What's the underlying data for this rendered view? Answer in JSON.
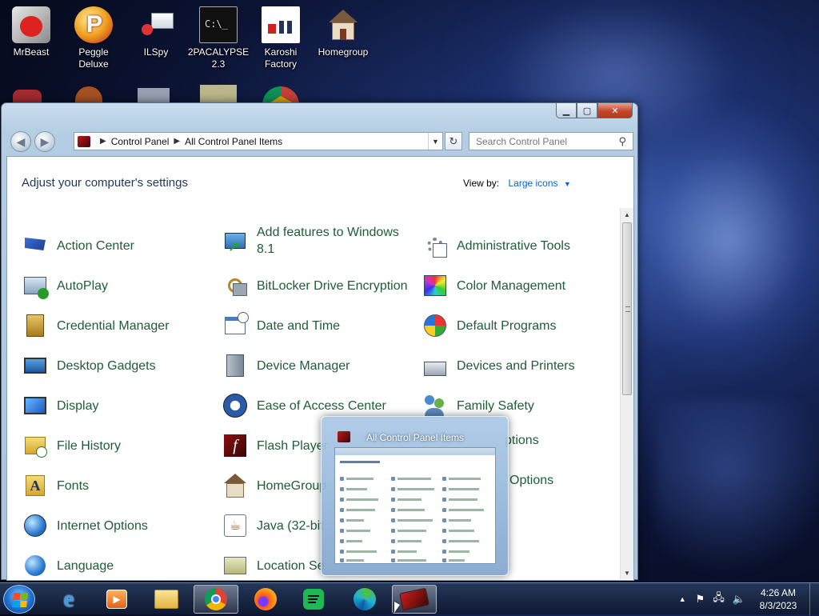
{
  "desktop": {
    "icons": [
      {
        "label": "MrBeast"
      },
      {
        "label": "Peggle Deluxe"
      },
      {
        "label": "ILSpy"
      },
      {
        "label": "2PACALYPSE 2.3"
      },
      {
        "label": "Karoshi Factory"
      },
      {
        "label": "Homegroup"
      }
    ]
  },
  "window": {
    "breadcrumb": [
      "Control Panel",
      "All Control Panel Items"
    ],
    "search_placeholder": "Search Control Panel",
    "heading": "Adjust your computer's settings",
    "view_by_label": "View by:",
    "view_by_value": "Large icons",
    "items": [
      {
        "label": "Action Center",
        "icon": "flag-icon"
      },
      {
        "label": "Add features to Windows 8.1",
        "icon": "add-features-icon"
      },
      {
        "label": "Administrative Tools",
        "icon": "admin-tools-icon"
      },
      {
        "label": "AutoPlay",
        "icon": "autoplay-icon"
      },
      {
        "label": "BitLocker Drive Encryption",
        "icon": "bitlocker-icon"
      },
      {
        "label": "Color Management",
        "icon": "color-management-icon"
      },
      {
        "label": "Credential Manager",
        "icon": "credential-manager-icon"
      },
      {
        "label": "Date and Time",
        "icon": "calendar-clock-icon"
      },
      {
        "label": "Default Programs",
        "icon": "default-programs-icon"
      },
      {
        "label": "Desktop Gadgets",
        "icon": "desktop-gadgets-icon"
      },
      {
        "label": "Device Manager",
        "icon": "device-manager-icon"
      },
      {
        "label": "Devices and Printers",
        "icon": "printer-icon"
      },
      {
        "label": "Display",
        "icon": "display-icon"
      },
      {
        "label": "Ease of Access Center",
        "icon": "ease-of-access-icon"
      },
      {
        "label": "Family Safety",
        "icon": "family-safety-icon"
      },
      {
        "label": "File History",
        "icon": "file-history-icon"
      },
      {
        "label": "Flash Player",
        "icon": "flash-player-icon"
      },
      {
        "label": "ptions",
        "icon": ""
      },
      {
        "label": "Fonts",
        "icon": "fonts-icon"
      },
      {
        "label": "HomeGroup",
        "icon": "homegroup-icon"
      },
      {
        "label": "Options",
        "icon": ""
      },
      {
        "label": "Internet Options",
        "icon": "internet-options-icon"
      },
      {
        "label": "Java (32-bit",
        "icon": "java-icon"
      },
      {
        "label": "",
        "icon": ""
      },
      {
        "label": "Language",
        "icon": "language-icon"
      },
      {
        "label": "Location Se",
        "icon": "location-settings-icon"
      }
    ]
  },
  "thumbnail": {
    "title": "All Control Panel Items"
  },
  "taskbar": {
    "apps": [
      "internet-explorer-icon",
      "media-player-icon",
      "file-explorer-icon",
      "chrome-icon",
      "firefox-icon",
      "spotify-icon",
      "edge-icon",
      "control-panel-icon"
    ],
    "time": "4:26 AM",
    "date": "8/3/2023"
  },
  "colors": {
    "link_green": "#1e5d36",
    "heading_blue": "#1e395b",
    "accent_blue": "#0066cc"
  }
}
